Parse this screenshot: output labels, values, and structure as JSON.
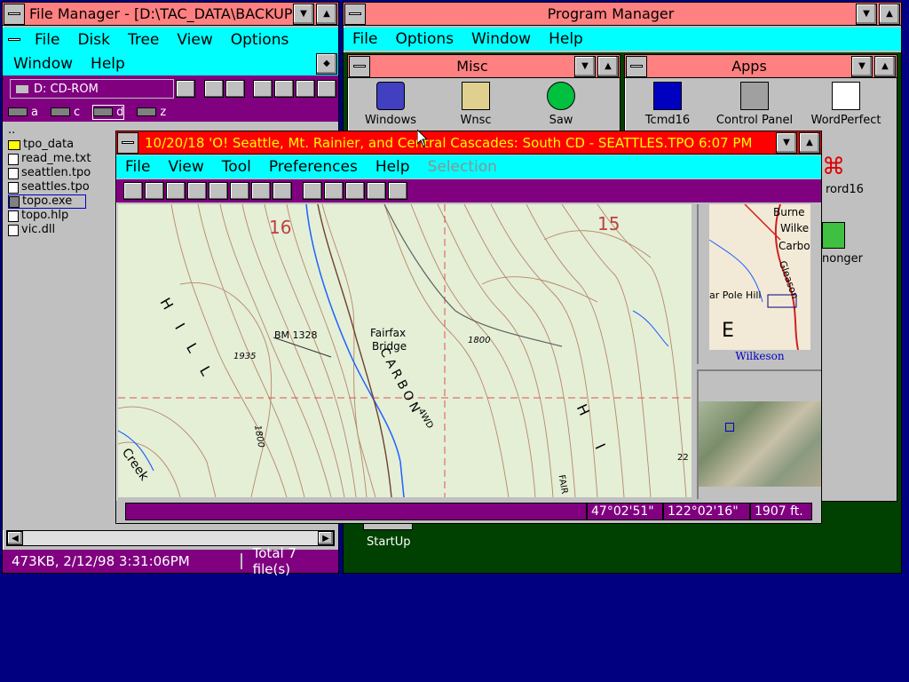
{
  "file_manager": {
    "title": "File Manager - [D:\\TAC_DATA\\BACKUP",
    "menu": [
      "File",
      "Disk",
      "Tree",
      "View",
      "Options",
      "Window",
      "Help"
    ],
    "drive_select": "D: CD-ROM",
    "drives": [
      "a",
      "c",
      "d",
      "z"
    ],
    "up_dir": "..",
    "files": [
      {
        "name": "tpo_data",
        "type": "folder"
      },
      {
        "name": "read_me.txt",
        "type": "file"
      },
      {
        "name": "seattlen.tpo",
        "type": "file"
      },
      {
        "name": "seattles.tpo",
        "type": "file"
      },
      {
        "name": "topo.exe",
        "type": "exe",
        "selected": true
      },
      {
        "name": "topo.hlp",
        "type": "file"
      },
      {
        "name": "vic.dll",
        "type": "file"
      }
    ],
    "status_left": "473KB, 2/12/98 3:31:06PM",
    "status_right": "Total 7 file(s)"
  },
  "program_manager": {
    "title": "Program Manager",
    "menu": [
      "File",
      "Options",
      "Window",
      "Help"
    ],
    "misc": {
      "title": "Misc",
      "icons": [
        "Windows",
        "Wnsc",
        "Saw"
      ]
    },
    "apps": {
      "title": "Apps",
      "icons": [
        "Tcmd16",
        "Control Panel",
        "WordPerfect"
      ],
      "partial_labels": [
        "rord16",
        "nonger"
      ]
    },
    "startup_label": "StartUp"
  },
  "topo": {
    "title": "10/20/18 'O! Seattle, Mt. Rainier, and Central Cascades: South CD - SEATTLES.TPO  6:07 PM",
    "menu": [
      "File",
      "View",
      "Tool",
      "Preferences",
      "Help",
      "Selection"
    ],
    "map_labels": {
      "sec16": "16",
      "sec15": "15",
      "hill_left": "H I L L",
      "bm": "BM 1328",
      "fairfax": "Fairfax",
      "bridge": "Bridge",
      "carbon": "CARBON",
      "e1935": "1935",
      "e1800a": "1800",
      "e1800b": "1800",
      "creek": "Creek",
      "fourwd": "4WD",
      "hill_right": "H I",
      "fair": "FAIR",
      "e22": "22"
    },
    "overview": {
      "labels": [
        "Burne",
        "Wilke",
        "Carbo",
        "Gleason",
        "ar Pole Hill",
        "E"
      ],
      "caption": "Wilkeson"
    },
    "status": {
      "lat": "47°02'51\"",
      "lon": "122°02'16\"",
      "elev": "1907 ft."
    },
    "colors": {
      "title_bar": "#ff0000",
      "title_text": "#ffff00",
      "toolbar": "#800080",
      "menu": "#00ffff",
      "map_bg": "#e4efd6",
      "contour": "#b8866a",
      "grid": "#e05050"
    }
  }
}
